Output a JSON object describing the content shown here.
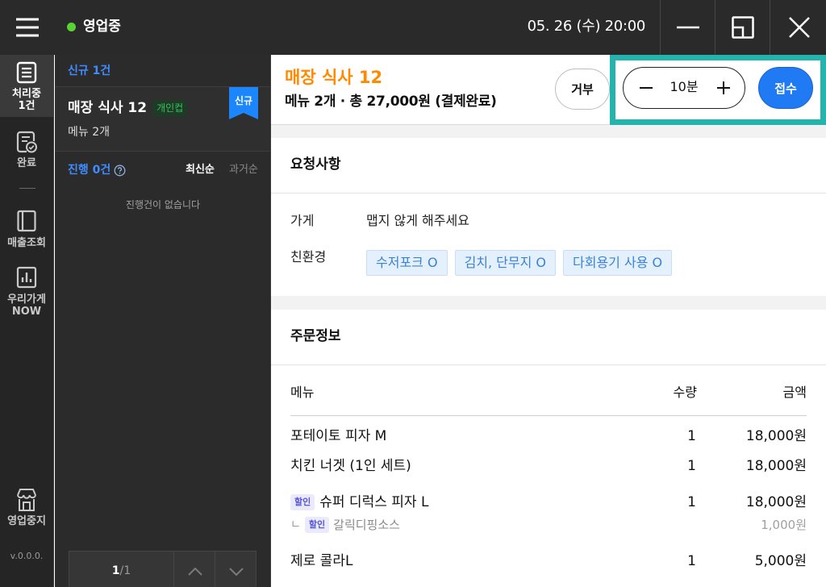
{
  "colors": {
    "topbar_bg": "#2a2a2a",
    "status_online": "#57d334",
    "accent_blue": "#3f8cff",
    "accept_blue": "#1f7af4",
    "title_orange": "#ff8a00",
    "highlight_teal": "#25b4ad",
    "eco_chip_bg": "#e4f0fc",
    "eco_chip_text": "#3b82d6",
    "discount_badge_bg": "#ebeafb",
    "discount_badge_text": "#5756d4",
    "personal_cup_green": "#34c35a",
    "new_ribbon_blue": "#1c86ff"
  },
  "topbar": {
    "menu_icon": "hamburger-menu-icon",
    "status_label": "영업중",
    "datetime": "05. 26 (수) 20:00",
    "window_controls": [
      "minimize-icon",
      "restore-window-icon",
      "close-icon"
    ]
  },
  "sidebar": {
    "items": [
      {
        "icon": "order-list-icon",
        "label": "처리중",
        "label_line2": "1건",
        "active": true
      },
      {
        "icon": "completed-order-icon",
        "label": "완료",
        "active": false
      },
      {
        "icon": "sales-ledger-icon",
        "label": "매출조회",
        "active": false
      },
      {
        "icon": "store-stats-icon",
        "label": "우리가게",
        "label_line2": "NOW",
        "active": false
      }
    ],
    "pause": {
      "icon": "store-pause-icon",
      "label": "영업중지"
    },
    "version": "v.0.0.0."
  },
  "order_list": {
    "new_header": "신규 1건",
    "new_orders": [
      {
        "title": "매장 식사 12",
        "badge": "개인컵",
        "summary": "메뉴 2개",
        "ribbon": "신규"
      }
    ],
    "progress_header": "진행 0건",
    "help_icon": "question-circle-icon",
    "sort_options": [
      {
        "label": "최신순",
        "selected": true
      },
      {
        "label": "과거순",
        "selected": false
      }
    ],
    "empty_text": "진행건이 없습니다",
    "pagination": {
      "current": "1",
      "separator": "/",
      "total": "1"
    }
  },
  "order_detail": {
    "title": "매장 식사 12",
    "summary": "메뉴 2개 · 총 27,000원 (결제완료)",
    "reject_label": "거부",
    "prep_time": "10분",
    "accept_label": "접수",
    "requests": {
      "heading": "요청사항",
      "store_label": "가게",
      "store_request": "맵지 않게 해주세요",
      "eco_label": "친환경",
      "eco_chips": [
        "수저포크 O",
        "김치, 단무지 O",
        "다회용기 사용 O"
      ]
    },
    "order_info": {
      "heading": "주문정보",
      "columns": {
        "menu": "메뉴",
        "quantity": "수량",
        "amount": "금액"
      },
      "items": [
        {
          "name": "포테이토 피자 M",
          "quantity": "1",
          "price": "18,000원"
        },
        {
          "name": "치킨 너겟 (1인 세트)",
          "quantity": "1",
          "price": "18,000원"
        },
        {
          "badge": "할인",
          "name": "슈퍼 디럭스 피자 L",
          "quantity": "1",
          "price": "18,000원",
          "options": [
            {
              "prefix": "ㄴ",
              "badge": "할인",
              "name": "갈릭디핑소스",
              "price": "1,000원"
            }
          ]
        },
        {
          "name": "제로 콜라L",
          "quantity": "1",
          "price": "5,000원"
        }
      ]
    }
  }
}
